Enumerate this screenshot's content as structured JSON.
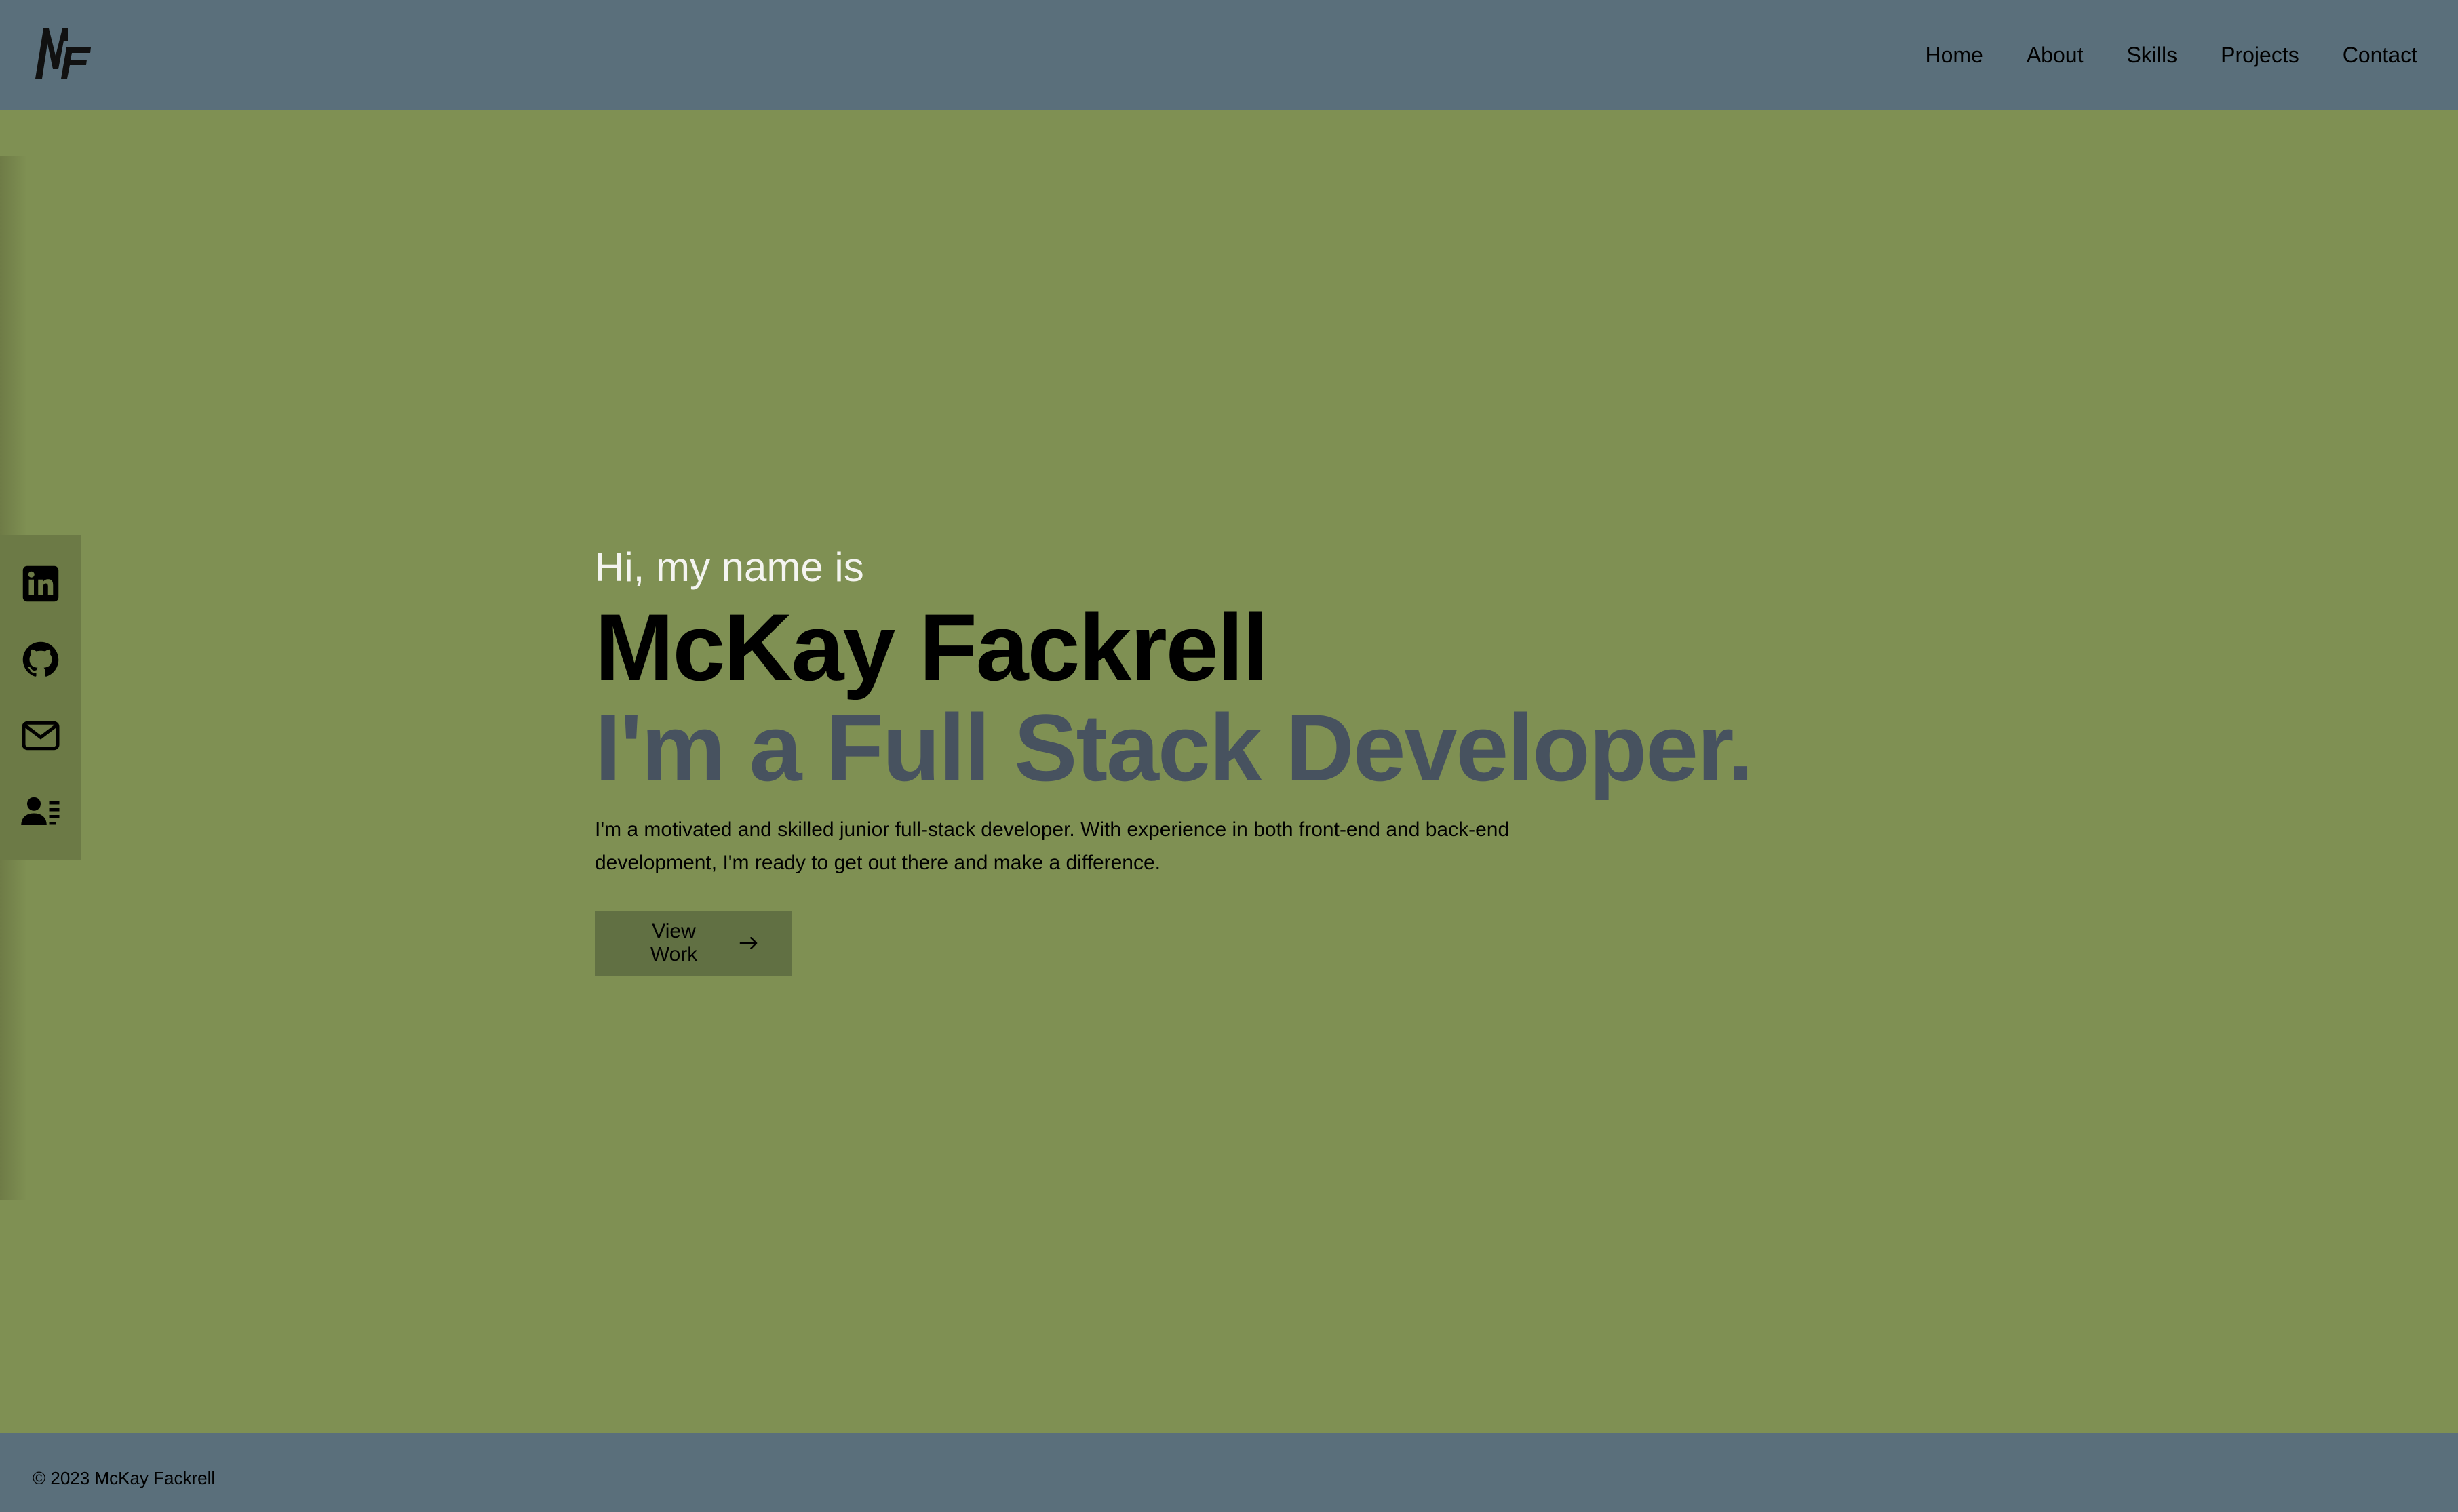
{
  "header": {
    "logo_alt": "MF",
    "nav": [
      {
        "label": "Home"
      },
      {
        "label": "About"
      },
      {
        "label": "Skills"
      },
      {
        "label": "Projects"
      },
      {
        "label": "Contact"
      }
    ]
  },
  "social": [
    {
      "icon": "linkedin-icon"
    },
    {
      "icon": "github-icon"
    },
    {
      "icon": "mail-icon"
    },
    {
      "icon": "resume-icon"
    }
  ],
  "hero": {
    "greeting": "Hi, my name is",
    "name": "McKay Fackrell",
    "role": "I'm a Full Stack Developer.",
    "description": "I'm a motivated and skilled junior full-stack developer. With experience in both front-end and back-end development, I'm ready to get out there and make a difference.",
    "button_label": "View Work",
    "button_icon": "arrow-right-icon"
  },
  "footer": {
    "copyright": "© 2023 McKay Fackrell"
  },
  "colors": {
    "background": "#7f9053",
    "header": "#5a6f7b",
    "accent_text": "#47525f",
    "button": "#617043",
    "greeting": "#f4f4f0"
  }
}
